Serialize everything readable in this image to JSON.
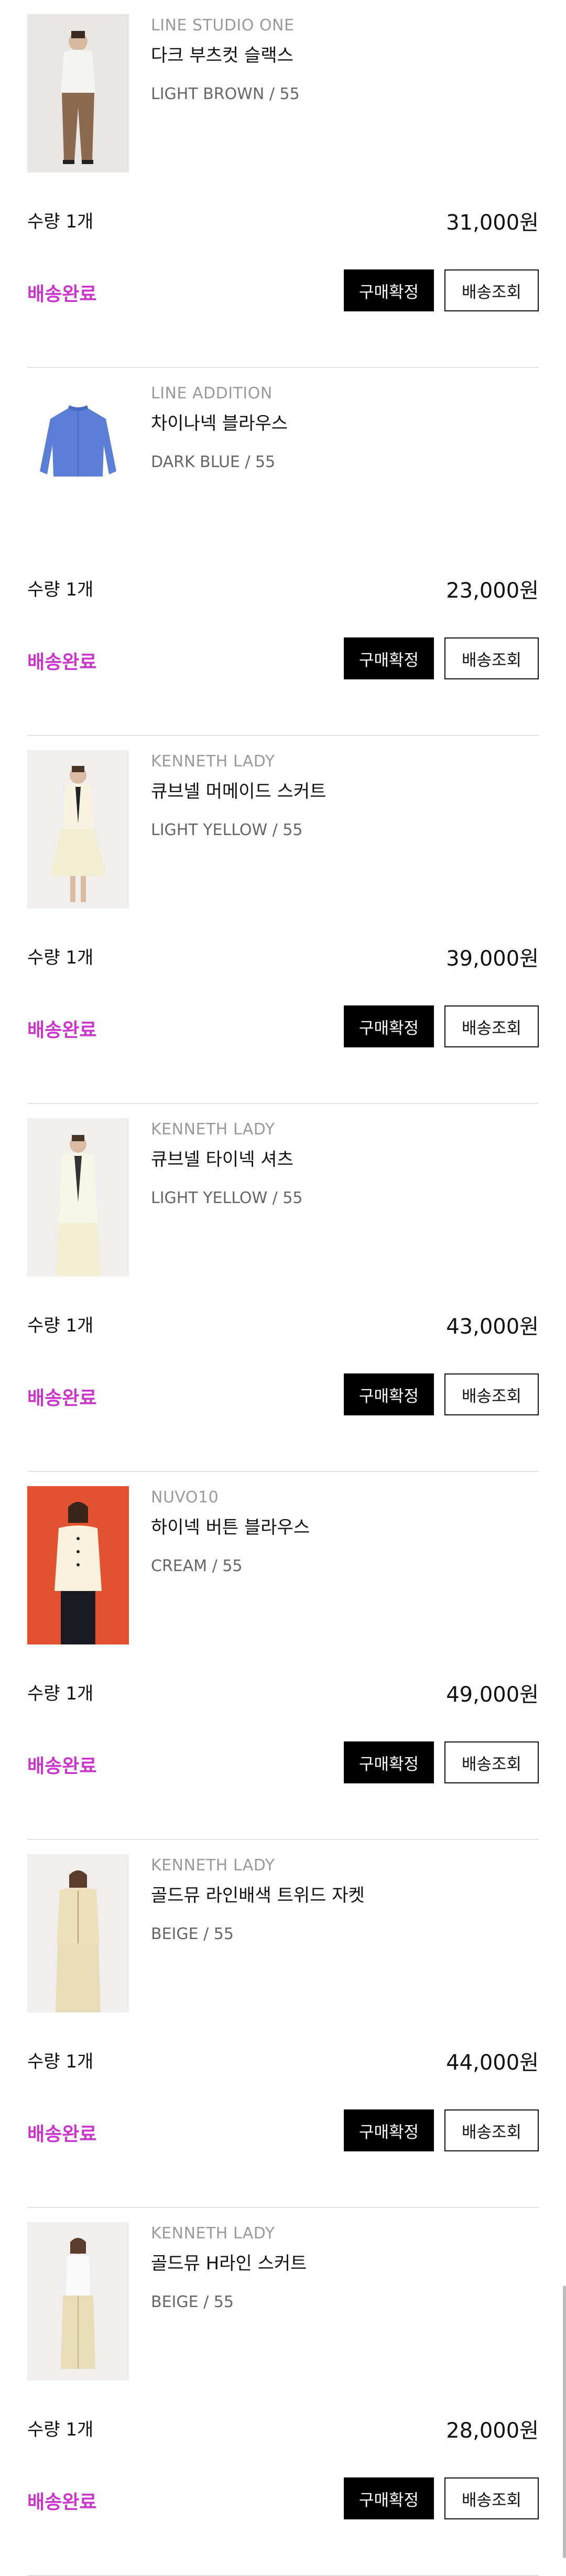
{
  "orders": [
    {
      "brand": "LINE STUDIO ONE",
      "name": "다크 부츠컷 슬랙스",
      "option": "LIGHT BROWN / 55",
      "qty": "수량 1개",
      "price": "31,000원",
      "status": "배송완료",
      "confirm_label": "구매확정",
      "track_label": "배송조회"
    },
    {
      "brand": "LINE ADDITION",
      "name": "차이나넥 블라우스",
      "option": "DARK BLUE / 55",
      "qty": "수량 1개",
      "price": "23,000원",
      "status": "배송완료",
      "confirm_label": "구매확정",
      "track_label": "배송조회"
    },
    {
      "brand": "KENNETH LADY",
      "name": "큐브넬 머메이드 스커트",
      "option": "LIGHT YELLOW / 55",
      "qty": "수량 1개",
      "price": "39,000원",
      "status": "배송완료",
      "confirm_label": "구매확정",
      "track_label": "배송조회"
    },
    {
      "brand": "KENNETH LADY",
      "name": "큐브넬 타이넥 셔츠",
      "option": "LIGHT YELLOW / 55",
      "qty": "수량 1개",
      "price": "43,000원",
      "status": "배송완료",
      "confirm_label": "구매확정",
      "track_label": "배송조회"
    },
    {
      "brand": "NUVO10",
      "name": "하이넥 버튼 블라우스",
      "option": "CREAM / 55",
      "qty": "수량 1개",
      "price": "49,000원",
      "status": "배송완료",
      "confirm_label": "구매확정",
      "track_label": "배송조회"
    },
    {
      "brand": "KENNETH LADY",
      "name": "골드뮤 라인배색 트위드 자켓",
      "option": "BEIGE / 55",
      "qty": "수량 1개",
      "price": "44,000원",
      "status": "배송완료",
      "confirm_label": "구매확정",
      "track_label": "배송조회"
    },
    {
      "brand": "KENNETH LADY",
      "name": "골드뮤 H라인 스커트",
      "option": "BEIGE / 55",
      "qty": "수량 1개",
      "price": "28,000원",
      "status": "배송완료",
      "confirm_label": "구매확정",
      "track_label": "배송조회"
    }
  ],
  "colors": {
    "status_delivered": "#cc33cc",
    "confirm_button_bg": "#000000",
    "divider": "#e2e2e2"
  }
}
